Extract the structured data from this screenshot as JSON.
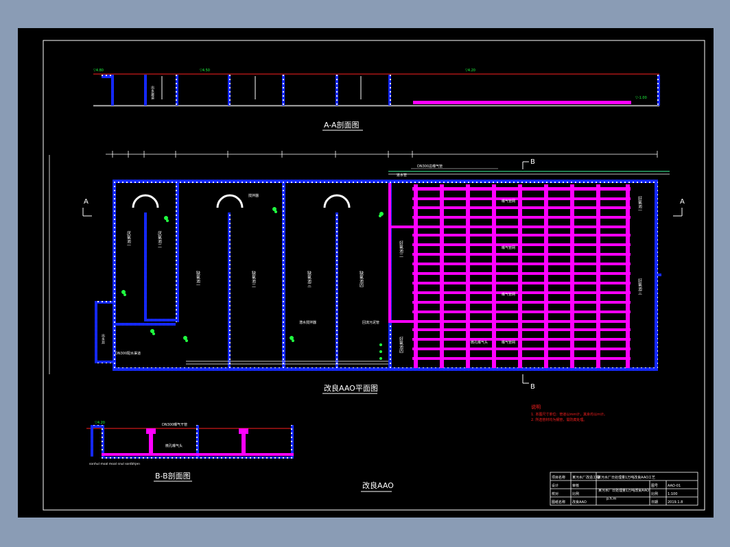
{
  "titles": {
    "section_aa": "A-A剖面图",
    "plan": "改良AAO平面图",
    "section_bb": "B-B剖面图",
    "sheet": "改良AAO"
  },
  "section_markers": {
    "a_left": "A",
    "a_right": "A",
    "b_top": "B",
    "b_bottom": "B"
  },
  "notes": {
    "heading": "说明",
    "line1": "1. 本图尺寸单位：管道以mm计，其余均以m计。",
    "line2": "2. 所选管材均为钢管，需防腐处理。"
  },
  "plan_labels": {
    "anaerobic_1": "厌氧池一",
    "anaerobic_2": "厌氧池二",
    "anoxic_1": "缺氧池一",
    "anoxic_2": "缺氧池二",
    "anoxic_3": "缺氧池三",
    "anoxic_4": "缺氧池四",
    "aerobic_1": "好氧池一",
    "aerobic_2": "好氧池二",
    "aerobic_3": "好氧池三",
    "aerobic_4": "好氧池四",
    "aeration_1": "曝气管网",
    "aeration_2": "曝气管网",
    "aeration_3": "曝气管网",
    "aeration_4": "曝气管网",
    "aerator": "微孔曝气头",
    "mixer": "潜水搅拌器",
    "stirrer": "搅拌器",
    "inflow": "进水管",
    "sludge": "回流污泥管",
    "outlet": "出水井",
    "bottom_channel": "DN300配水渠道",
    "pipe_top": "DN300总曝气管"
  },
  "bb_labels": {
    "pipe": "DN300曝气干管",
    "aerator": "微孔曝气头",
    "bottom": "sonhul moal moal snul sonlbhjen"
  },
  "title_block": {
    "row1_a": "项目名称",
    "row1_b": "某污水厂改造工程",
    "row1_c": "某污水厂日处理量1万吨改良AAO工艺",
    "row2_a": "设计",
    "row2_b": "审核",
    "row3_a": "校对",
    "row3_b": "比例",
    "row4_a": "图纸名称",
    "row4_b": "改良AAO",
    "drawing": "某污水厂日处理量1万吨改良AAO",
    "drawing2": "p.h.m",
    "no_label": "图号",
    "no_value": "AAO-01",
    "scale_label": "比例",
    "scale_value": "1:100",
    "date_label": "日期",
    "date_value": "2019.1.8"
  },
  "colors": {
    "wall": "#1428ff",
    "pipe": "#ff00ff",
    "water": "#ff2020",
    "line": "#ffffff",
    "equipment": "#20ff40",
    "sheet": "#000000",
    "background": "#8a9cb5"
  }
}
